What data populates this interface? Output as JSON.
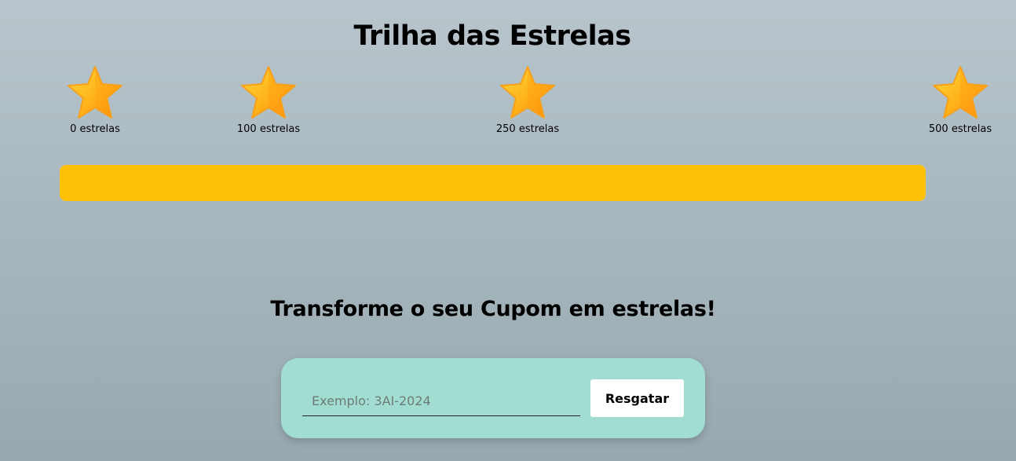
{
  "page": {
    "title": "Trilha das Estrelas",
    "subtitle": "Transforme o seu Cupom em estrelas!"
  },
  "milestones": [
    {
      "label": "0 estrelas",
      "icon": "star-icon"
    },
    {
      "label": "100 estrelas",
      "icon": "star-icon"
    },
    {
      "label": "250 estrelas",
      "icon": "star-icon"
    },
    {
      "label": "500 estrelas",
      "icon": "star-icon"
    }
  ],
  "progress": {
    "fill_fraction": 1.0,
    "color": "#fec107"
  },
  "redeem": {
    "placeholder": "Exemplo: 3AI-2024",
    "value": "",
    "button_label": "Resgatar",
    "card_color": "#a1ded1"
  }
}
